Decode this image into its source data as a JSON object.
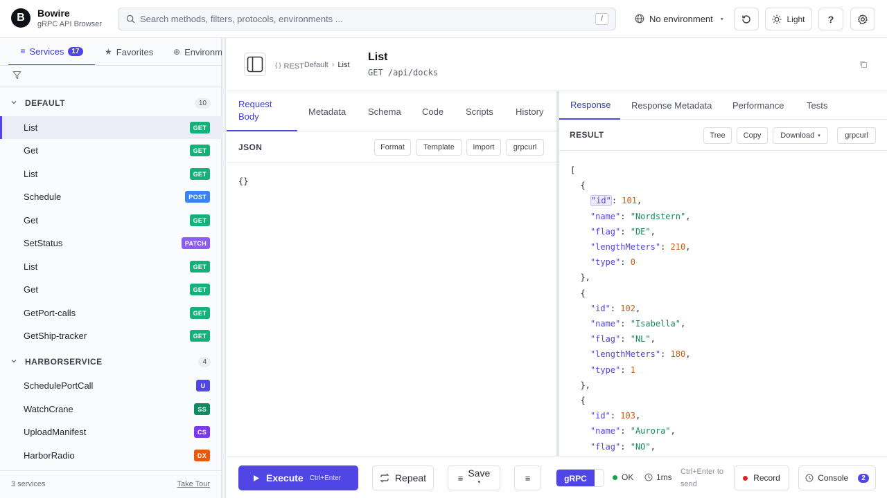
{
  "header": {
    "logo_letter": "B",
    "app_name": "Bowire",
    "app_subtitle": "gRPC API Browser",
    "search_placeholder": "Search methods, filters, protocols, environments ...",
    "search_shortcut": "/",
    "environment": "No environment",
    "theme_label": "Light",
    "help_label": "?"
  },
  "sidebar": {
    "tabs": [
      {
        "label": "Services",
        "count": "17",
        "active": true
      },
      {
        "label": "Favorites"
      },
      {
        "label": "Environments"
      }
    ],
    "groups": [
      {
        "name": "DEFAULT",
        "count": "10",
        "methods": [
          {
            "name": "List",
            "badge": "GET",
            "selected": true
          },
          {
            "name": "Get",
            "badge": "GET"
          },
          {
            "name": "List",
            "badge": "GET"
          },
          {
            "name": "Schedule",
            "badge": "POST"
          },
          {
            "name": "Get",
            "badge": "GET"
          },
          {
            "name": "SetStatus",
            "badge": "PATCH"
          },
          {
            "name": "List",
            "badge": "GET"
          },
          {
            "name": "Get",
            "badge": "GET"
          },
          {
            "name": "GetPort-calls",
            "badge": "GET"
          },
          {
            "name": "GetShip-tracker",
            "badge": "GET"
          }
        ]
      },
      {
        "name": "HARBORSERVICE",
        "count": "4",
        "methods": [
          {
            "name": "SchedulePortCall",
            "badge": "U"
          },
          {
            "name": "WatchCrane",
            "badge": "SS"
          },
          {
            "name": "UploadManifest",
            "badge": "CS"
          },
          {
            "name": "HarborRadio",
            "badge": "DX"
          }
        ]
      }
    ],
    "footer": {
      "services": "3 services",
      "tour": "Take Tour"
    }
  },
  "badge_colors": {
    "GET": "#16b07a",
    "POST": "#3b82f6",
    "PATCH": "#8b5cf6",
    "U": "#4f46e5",
    "SS": "#0f8a5f",
    "CS": "#7c3aed",
    "DX": "#ea580c"
  },
  "method": {
    "breadcrumb_icon": "{ }",
    "protocol": "REST",
    "group": "Default",
    "name": "List",
    "title": "List",
    "verb_path": "GET /api/docks"
  },
  "request": {
    "tabs": [
      "Request\nBody",
      "Metadata",
      "Schema",
      "Code",
      "Scripts",
      "History"
    ],
    "section_label": "JSON",
    "tools": [
      "Format",
      "Template",
      "Import",
      "grpcurl"
    ],
    "body": "{}"
  },
  "response": {
    "tabs": [
      "Response",
      "Response Metadata",
      "Performance",
      "Tests"
    ],
    "section_label": "RESULT",
    "tools": [
      "Tree",
      "Copy",
      "Download",
      "grpcurl"
    ],
    "json_lines": [
      [
        [
          "p",
          "["
        ]
      ],
      [
        [
          "p",
          "  {"
        ]
      ],
      [
        [
          "p",
          "    "
        ],
        [
          "kh",
          "\"id\""
        ],
        [
          "p",
          ": "
        ],
        [
          "n",
          "101"
        ],
        [
          "p",
          ","
        ]
      ],
      [
        [
          "p",
          "    "
        ],
        [
          "k",
          "\"name\""
        ],
        [
          "p",
          ": "
        ],
        [
          "s",
          "\"Nordstern\""
        ],
        [
          "p",
          ","
        ]
      ],
      [
        [
          "p",
          "    "
        ],
        [
          "k",
          "\"flag\""
        ],
        [
          "p",
          ": "
        ],
        [
          "s",
          "\"DE\""
        ],
        [
          "p",
          ","
        ]
      ],
      [
        [
          "p",
          "    "
        ],
        [
          "k",
          "\"lengthMeters\""
        ],
        [
          "p",
          ": "
        ],
        [
          "n",
          "210"
        ],
        [
          "p",
          ","
        ]
      ],
      [
        [
          "p",
          "    "
        ],
        [
          "k",
          "\"type\""
        ],
        [
          "p",
          ": "
        ],
        [
          "n",
          "0"
        ]
      ],
      [
        [
          "p",
          "  },"
        ]
      ],
      [
        [
          "p",
          "  {"
        ]
      ],
      [
        [
          "p",
          "    "
        ],
        [
          "k",
          "\"id\""
        ],
        [
          "p",
          ": "
        ],
        [
          "n",
          "102"
        ],
        [
          "p",
          ","
        ]
      ],
      [
        [
          "p",
          "    "
        ],
        [
          "k",
          "\"name\""
        ],
        [
          "p",
          ": "
        ],
        [
          "s",
          "\"Isabella\""
        ],
        [
          "p",
          ","
        ]
      ],
      [
        [
          "p",
          "    "
        ],
        [
          "k",
          "\"flag\""
        ],
        [
          "p",
          ": "
        ],
        [
          "s",
          "\"NL\""
        ],
        [
          "p",
          ","
        ]
      ],
      [
        [
          "p",
          "    "
        ],
        [
          "k",
          "\"lengthMeters\""
        ],
        [
          "p",
          ": "
        ],
        [
          "n",
          "180"
        ],
        [
          "p",
          ","
        ]
      ],
      [
        [
          "p",
          "    "
        ],
        [
          "k",
          "\"type\""
        ],
        [
          "p",
          ": "
        ],
        [
          "n",
          "1"
        ]
      ],
      [
        [
          "p",
          "  },"
        ]
      ],
      [
        [
          "p",
          "  {"
        ]
      ],
      [
        [
          "p",
          "    "
        ],
        [
          "k",
          "\"id\""
        ],
        [
          "p",
          ": "
        ],
        [
          "n",
          "103"
        ],
        [
          "p",
          ","
        ]
      ],
      [
        [
          "p",
          "    "
        ],
        [
          "k",
          "\"name\""
        ],
        [
          "p",
          ": "
        ],
        [
          "s",
          "\"Aurora\""
        ],
        [
          "p",
          ","
        ]
      ],
      [
        [
          "p",
          "    "
        ],
        [
          "k",
          "\"flag\""
        ],
        [
          "p",
          ": "
        ],
        [
          "s",
          "\"NO\""
        ],
        [
          "p",
          ","
        ]
      ]
    ]
  },
  "bottom": {
    "execute_label": "Execute",
    "execute_shortcut": "Ctrl+Enter",
    "repeat_label": "Repeat",
    "save_label": "Save",
    "protocol_toggle": "gRPC",
    "status": "OK",
    "duration": "1ms",
    "hint": "Ctrl+Enter to send",
    "record_label": "Record",
    "console_label": "Console",
    "console_count": "2"
  },
  "colors": {
    "accent": "#4f46e5",
    "ok": "#16a34a",
    "record": "#dc2626"
  }
}
